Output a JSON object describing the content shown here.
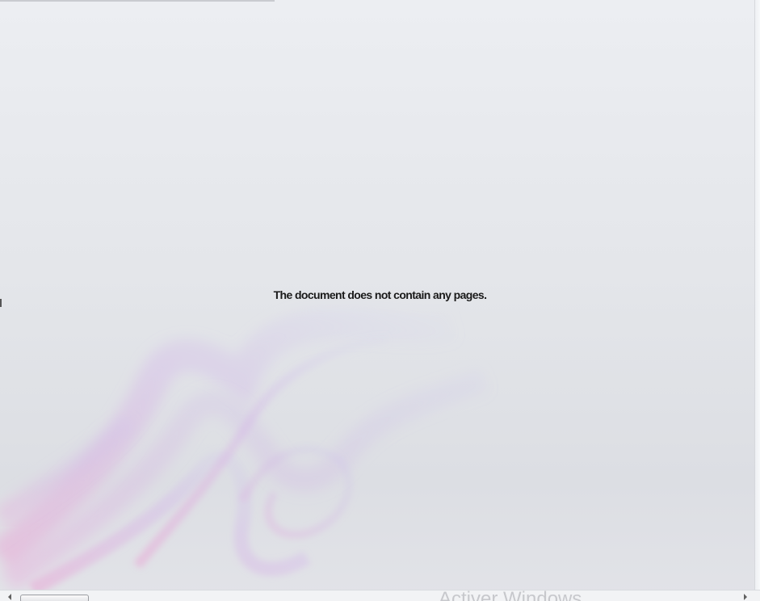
{
  "viewer": {
    "empty_message": "The document does not contain any pages."
  },
  "overlay": {
    "watermark_text": "Activer Windows"
  },
  "colors": {
    "background": "#e4e6ea",
    "smoke_primary": "#d8a6e0",
    "smoke_secondary": "#c7b6ee",
    "message_text": "#1a1a1a"
  },
  "icons": {
    "scroll_left": "scroll-left-arrow-icon",
    "scroll_right": "scroll-right-arrow-icon"
  }
}
